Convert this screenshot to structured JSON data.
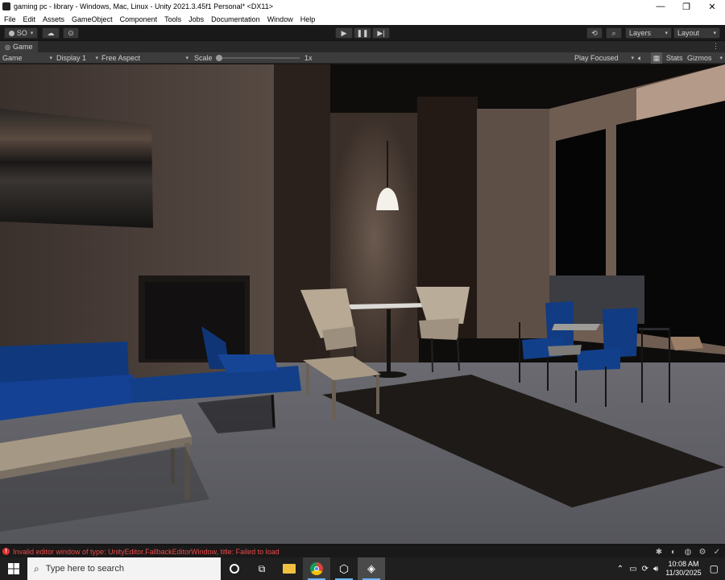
{
  "window": {
    "title": "gaming pc - library - Windows, Mac, Linux - Unity 2021.3.45f1 Personal* <DX11>",
    "controls": [
      "—",
      "❐",
      "✕"
    ]
  },
  "menu": [
    "File",
    "Edit",
    "Assets",
    "GameObject",
    "Component",
    "Tools",
    "Jobs",
    "Documentation",
    "Window",
    "Help"
  ],
  "toolbar": {
    "account_label": "SO",
    "layers_label": "Layers",
    "layout_label": "Layout"
  },
  "tab": {
    "label": "Game"
  },
  "gamebar": {
    "mode": "Game",
    "display": "Display 1",
    "aspect": "Free Aspect",
    "scale_label": "Scale",
    "scale_value": "1x",
    "scale_fraction": 0.0,
    "play_focused": "Play Focused",
    "stats": "Stats",
    "gizmos": "Gizmos"
  },
  "status": {
    "message": "Invalid editor window of type: UnityEditor.FallbackEditorWindow, title: Failed to load"
  },
  "taskbar": {
    "search_placeholder": "Type here to search",
    "time": "10:08 AM",
    "date": "11/30/2025"
  },
  "colors": {
    "editor_bg": "#191919",
    "panel": "#3c3c3c",
    "error": "#f04848",
    "sofa_blue": "#123f87",
    "floor": "#5a5a5f"
  },
  "icons": [
    "unity-icon",
    "cloud-icon",
    "collab-icon",
    "play-icon",
    "pause-icon",
    "step-icon",
    "history-icon",
    "search-icon",
    "audio-icon",
    "grid-icon",
    "error-icon",
    "windows-start-icon",
    "search-icon",
    "cortana-icon",
    "task-view-icon",
    "file-explorer-icon",
    "chrome-icon",
    "unity-hub-icon",
    "unity-editor-icon",
    "notification-icon"
  ]
}
